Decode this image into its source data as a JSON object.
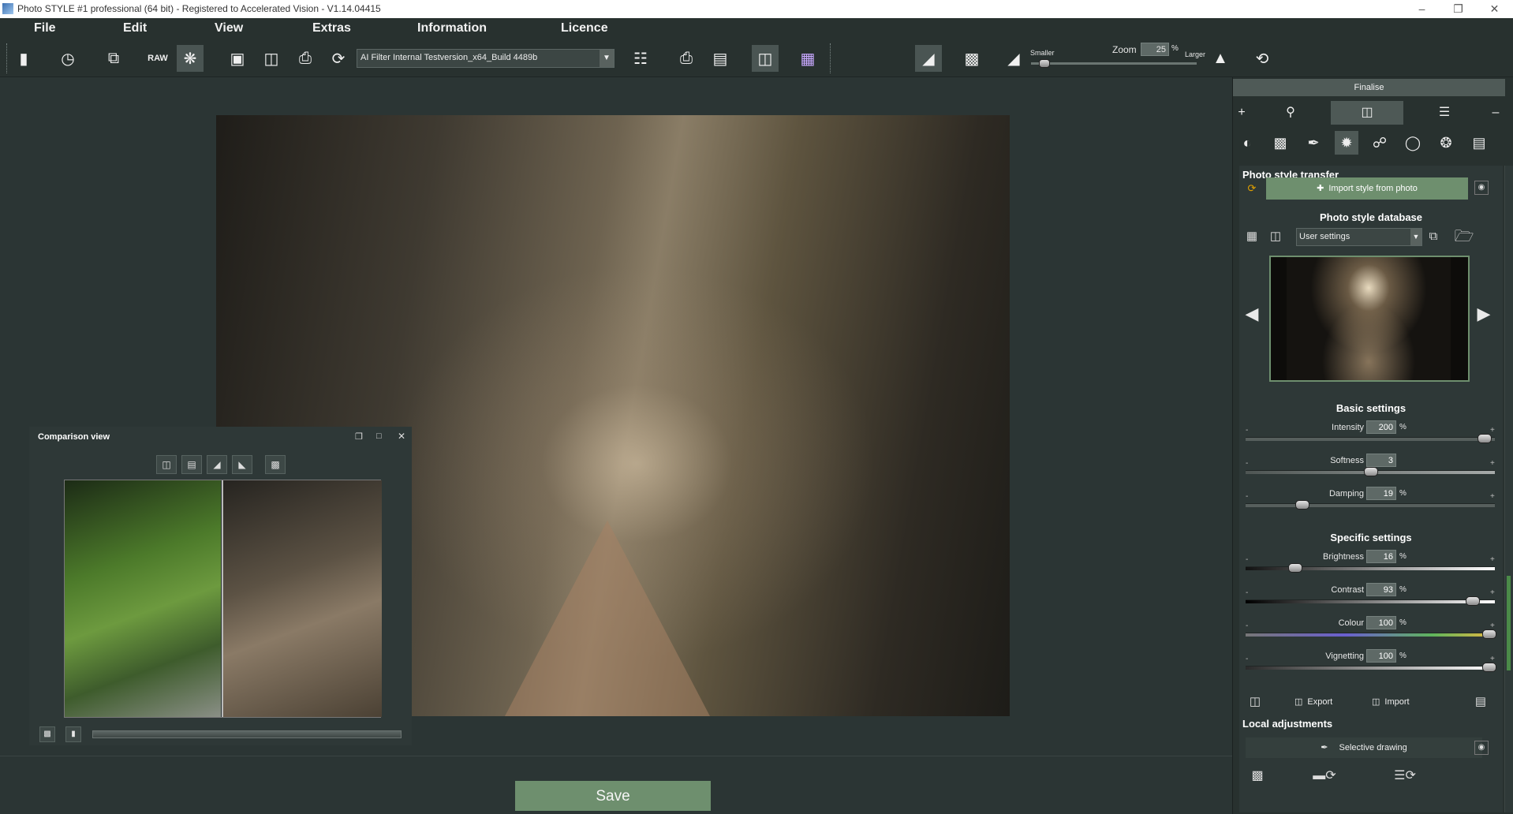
{
  "window": {
    "title": "Photo STYLE #1 professional (64 bit) - Registered to Accelerated Vision - V1.14.04415"
  },
  "menu": {
    "items": [
      "File",
      "Edit",
      "View",
      "Extras",
      "Information",
      "Licence"
    ]
  },
  "toolbar": {
    "filter_select": "AI Filter Internal Testversion_x64_Build 4489b",
    "zoom_label": "Zoom",
    "zoom_value": "25",
    "zoom_unit": "%",
    "smaller_label": "Smaller",
    "larger_label": "Larger",
    "zoom_level": 0.05
  },
  "comparison": {
    "title": "Comparison view"
  },
  "save_button": "Save",
  "panel": {
    "finalise_label": "Finalise",
    "style_transfer": {
      "heading": "Photo style transfer",
      "import_button": "Import style from photo"
    },
    "style_database": {
      "heading": "Photo style database",
      "select_value": "User settings"
    },
    "basic_settings": {
      "heading": "Basic settings",
      "sliders": [
        {
          "label": "Intensity",
          "value": "200",
          "unit": "%",
          "position": 0.98
        },
        {
          "label": "Softness",
          "value": "3",
          "unit": "",
          "position": 0.5
        },
        {
          "label": "Damping",
          "value": "19",
          "unit": "%",
          "position": 0.21
        }
      ]
    },
    "specific_settings": {
      "heading": "Specific settings",
      "sliders": [
        {
          "label": "Brightness",
          "value": "16",
          "unit": "%",
          "position": 0.18
        },
        {
          "label": "Contrast",
          "value": "93",
          "unit": "%",
          "position": 0.93
        },
        {
          "label": "Colour",
          "value": "100",
          "unit": "%",
          "position": 1.0
        },
        {
          "label": "Vignetting",
          "value": "100",
          "unit": "%",
          "position": 1.0
        }
      ]
    },
    "export_label": "Export",
    "import_label": "Import",
    "local_adjustments": {
      "heading": "Local adjustments",
      "selective_label": "Selective drawing"
    }
  }
}
